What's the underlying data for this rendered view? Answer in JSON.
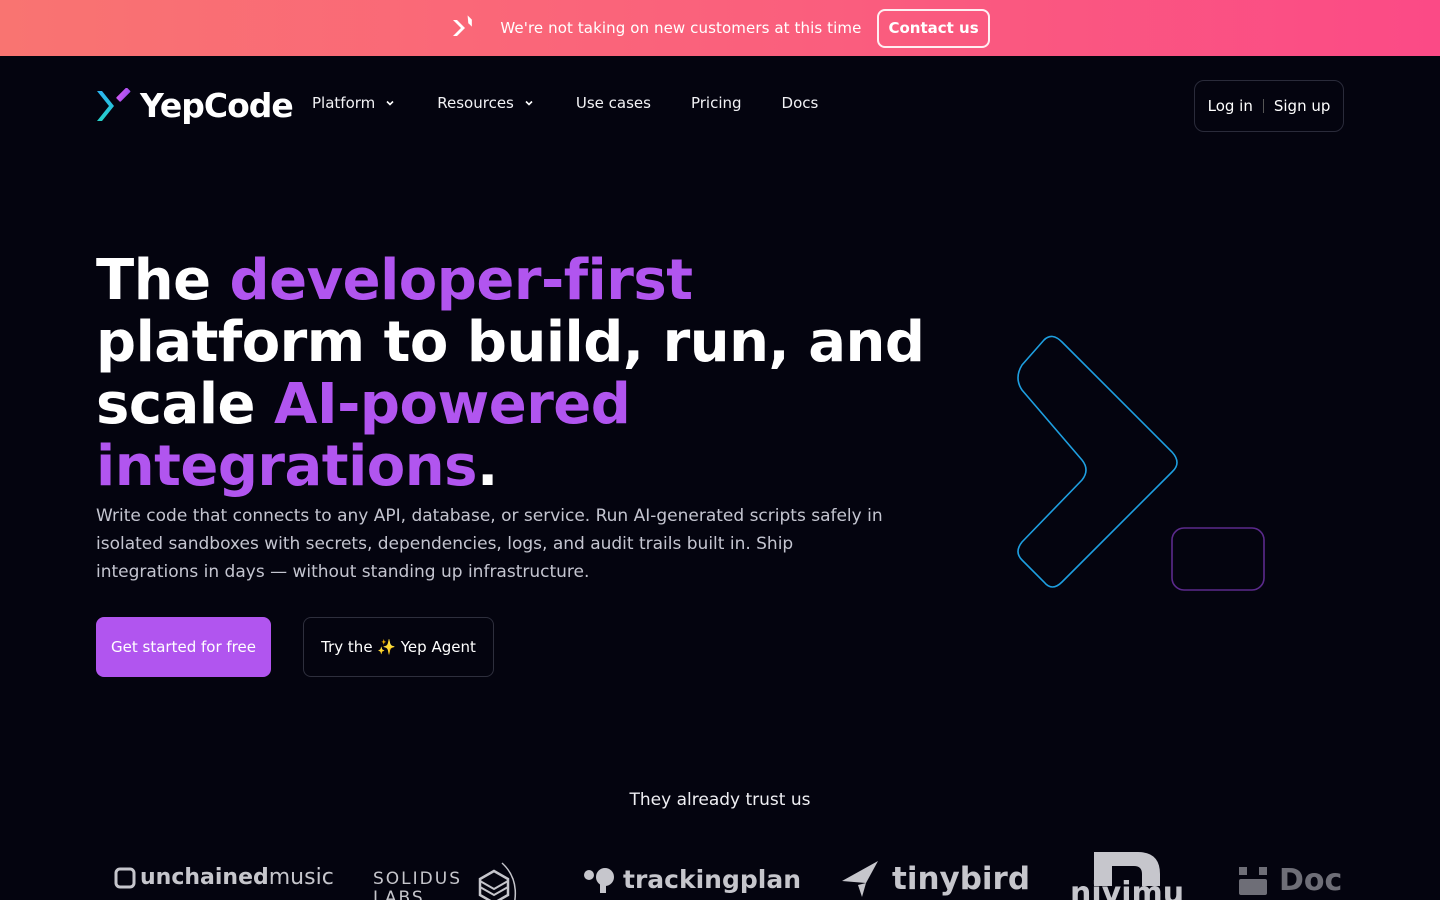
{
  "banner": {
    "message": "We're not taking on new customers at this time",
    "contact_label": "Contact us",
    "icon": "yepcode-mark-icon"
  },
  "nav": {
    "brand": "YepCode",
    "items": [
      {
        "label": "Platform",
        "has_dropdown": true
      },
      {
        "label": "Resources",
        "has_dropdown": true
      },
      {
        "label": "Use cases",
        "has_dropdown": false
      },
      {
        "label": "Pricing",
        "has_dropdown": false
      },
      {
        "label": "Docs",
        "has_dropdown": false
      }
    ],
    "login_label": "Log in",
    "signup_label": "Sign up"
  },
  "hero": {
    "title_part1": "The ",
    "title_accent1": "developer-first",
    "title_part2": " platform to build, run, and scale ",
    "title_accent2": "AI-powered integrations",
    "title_end": ".",
    "description": "Write code that connects to any API, database, or service. Run AI-generated scripts safely in isolated sandboxes with secrets, dependencies, logs, and audit trails built in. Ship integrations in days — without standing up infrastructure.",
    "primary_cta": "Get started for free",
    "secondary_cta": "Try the ✨ Yep Agent"
  },
  "trust": {
    "title": "They already trust us",
    "logos": [
      {
        "name": "unchained music",
        "part1": "unchained",
        "part2": "music"
      },
      {
        "name": "Solidus Labs",
        "line1": "SOLIDUS",
        "line2": "LABS"
      },
      {
        "name": "trackingplan",
        "text": "trackingplan"
      },
      {
        "name": "tinybird",
        "text": "tinybird"
      },
      {
        "name": "nivimu",
        "text": "nivimu"
      },
      {
        "name": "Doc",
        "text": "Doc"
      }
    ]
  },
  "colors": {
    "accent": "#b155ef",
    "background": "#04040f",
    "banner_start": "#f97471",
    "banner_end": "#fb4a86",
    "graphic_chevron": "#1e9fe0",
    "graphic_box": "#5b2a8c"
  }
}
